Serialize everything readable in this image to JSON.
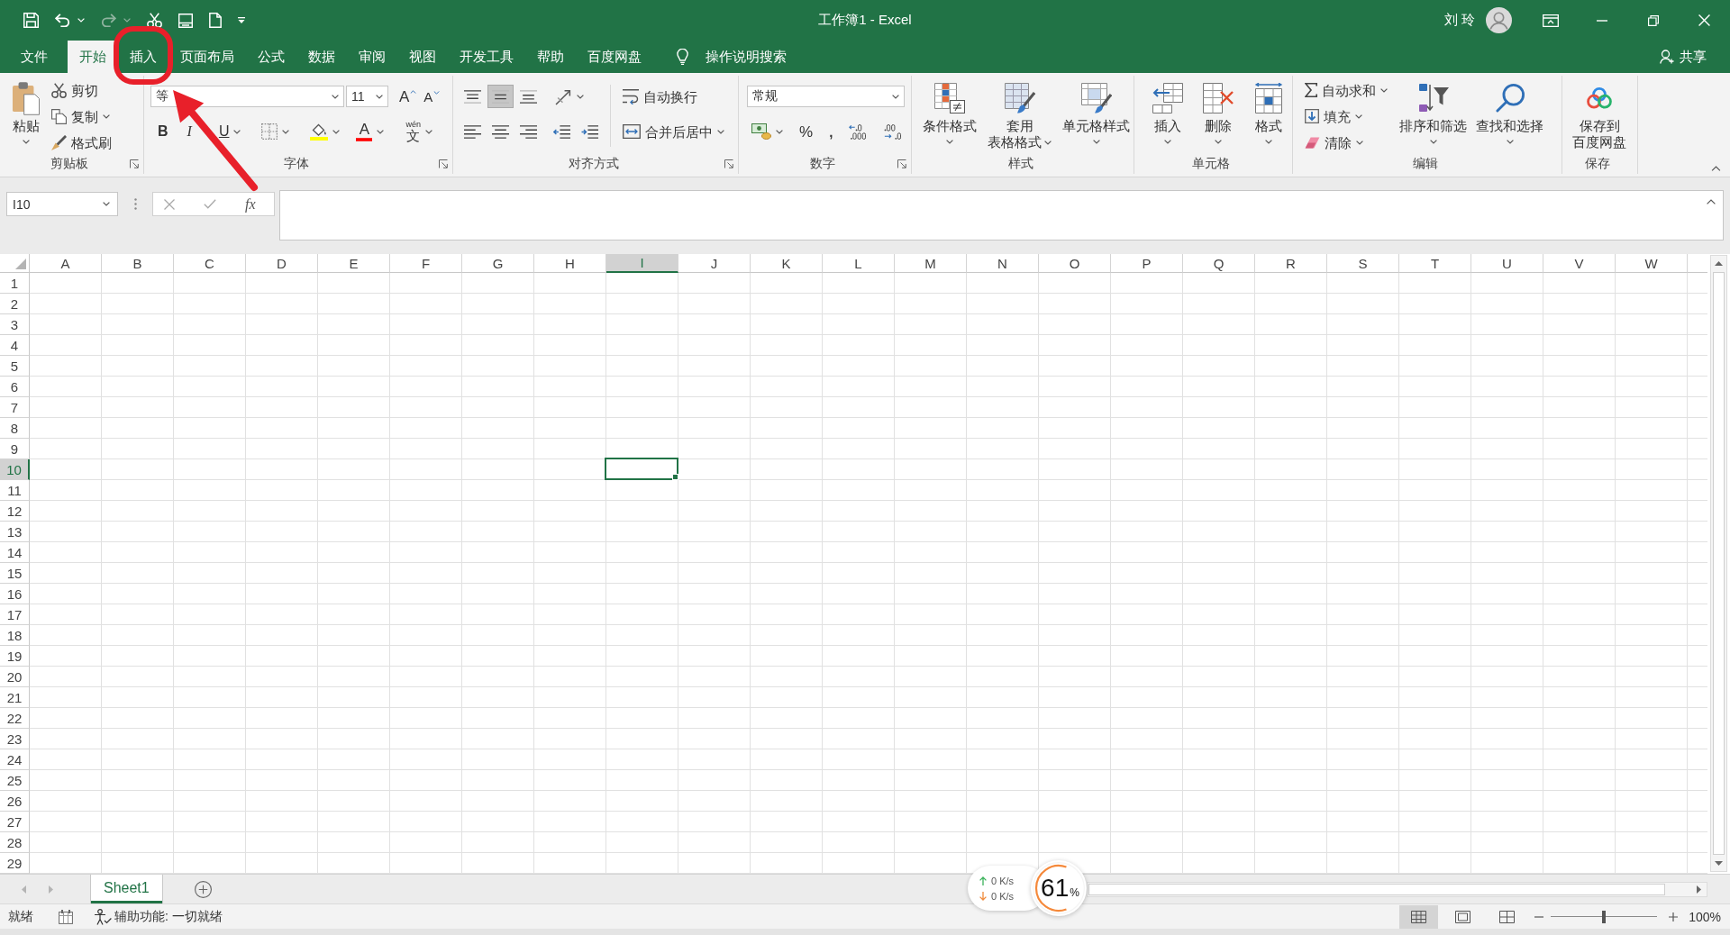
{
  "window": {
    "title": "工作簿1 - Excel",
    "user": "刘 玲"
  },
  "quick_access": [
    {
      "kind": "save",
      "disabled": false
    },
    {
      "kind": "undo",
      "disabled": false
    },
    {
      "kind": "redo",
      "disabled": true
    },
    {
      "kind": "cut",
      "disabled": false
    },
    {
      "kind": "form",
      "disabled": false
    },
    {
      "kind": "new",
      "disabled": false
    },
    {
      "kind": "customize",
      "disabled": false
    }
  ],
  "tabs": [
    {
      "label": "文件",
      "selected": false,
      "annotated": false
    },
    {
      "label": "开始",
      "selected": true,
      "annotated": false
    },
    {
      "label": "插入",
      "selected": false,
      "annotated": true
    },
    {
      "label": "页面布局",
      "selected": false,
      "annotated": false
    },
    {
      "label": "公式",
      "selected": false,
      "annotated": false
    },
    {
      "label": "数据",
      "selected": false,
      "annotated": false
    },
    {
      "label": "审阅",
      "selected": false,
      "annotated": false
    },
    {
      "label": "视图",
      "selected": false,
      "annotated": false
    },
    {
      "label": "开发工具",
      "selected": false,
      "annotated": false
    },
    {
      "label": "帮助",
      "selected": false,
      "annotated": false
    },
    {
      "label": "百度网盘",
      "selected": false,
      "annotated": false
    }
  ],
  "tell_me": {
    "label": "操作说明搜索"
  },
  "share": {
    "label": "共享"
  },
  "ribbon": {
    "groups": [
      {
        "title": "剪贴板",
        "launcher": true,
        "blocks": [
          {
            "kind": "large",
            "items": [
              {
                "kind": "paste",
                "lines": [
                  "粘贴"
                ],
                "menu": true
              }
            ]
          },
          {
            "kind": "stack",
            "items": [
              {
                "kind": "cut",
                "label": "剪切",
                "menu": false
              },
              {
                "kind": "copy",
                "label": "复制",
                "menu": true
              },
              {
                "kind": "painter",
                "label": "格式刷",
                "menu": false
              }
            ]
          }
        ]
      },
      {
        "title": "字体",
        "launcher": true,
        "blocks": [
          {
            "kind": "rows",
            "rows": [
              [
                {
                  "kind": "font-name",
                  "value": "等"
                },
                {
                  "kind": "font-size",
                  "value": "11"
                },
                {
                  "kind": "grow",
                  "label": "A",
                  "menu": false
                },
                {
                  "kind": "shrink",
                  "label": "A",
                  "menu": false
                }
              ],
              [
                {
                  "kind": "bold",
                  "label": "B",
                  "menu": false
                },
                {
                  "kind": "italic",
                  "label": "I",
                  "menu": false
                },
                {
                  "kind": "underline",
                  "label": "U",
                  "menu": true
                },
                {
                  "kind": "borders",
                  "menu": true
                },
                {
                  "kind": "fill",
                  "menu": true
                },
                {
                  "kind": "font-color",
                  "label": "A",
                  "menu": true
                },
                {
                  "kind": "phonetic",
                  "ruby": "wén",
                  "label": "文",
                  "menu": true
                }
              ]
            ]
          }
        ]
      },
      {
        "title": "对齐方式",
        "launcher": true,
        "blocks": [
          {
            "kind": "rows",
            "rows": [
              [
                {
                  "kind": "align-top",
                  "selected": false,
                  "menu": false
                },
                {
                  "kind": "align-middle",
                  "selected": true,
                  "menu": false
                },
                {
                  "kind": "align-bottom",
                  "selected": false,
                  "menu": false
                },
                {
                  "kind": "orientation",
                  "selected": false,
                  "menu": true
                }
              ],
              [
                {
                  "kind": "align-left",
                  "selected": false,
                  "menu": false
                },
                {
                  "kind": "align-center",
                  "selected": false,
                  "menu": false
                },
                {
                  "kind": "align-right",
                  "selected": false,
                  "menu": false
                },
                {
                  "kind": "indent-less",
                  "selected": false,
                  "menu": false
                },
                {
                  "kind": "indent-more",
                  "selected": false,
                  "menu": false
                }
              ]
            ]
          },
          {
            "kind": "rows",
            "rows": [
              [
                {
                  "kind": "wrap",
                  "label": "自动换行",
                  "selected": false,
                  "menu": false
                }
              ],
              [
                {
                  "kind": "merge",
                  "label": "合并后居中",
                  "selected": false,
                  "menu": true
                }
              ]
            ]
          }
        ]
      },
      {
        "title": "数字",
        "launcher": true,
        "blocks": [
          {
            "kind": "rows",
            "rows": [
              [
                {
                  "kind": "number-format",
                  "value": "常规"
                }
              ],
              [
                {
                  "kind": "accounting",
                  "menu": true
                },
                {
                  "kind": "percent",
                  "label": "%",
                  "menu": false
                },
                {
                  "kind": "comma",
                  "label": ",",
                  "menu": false
                },
                {
                  "kind": "decimal-more",
                  "menu": false
                },
                {
                  "kind": "decimal-less",
                  "menu": false
                }
              ]
            ]
          }
        ]
      },
      {
        "title": "样式",
        "launcher": false,
        "blocks": [
          {
            "kind": "large",
            "items": [
              {
                "kind": "conditional",
                "lines": [
                  "条件格式"
                ],
                "menu": true
              },
              {
                "kind": "table-format",
                "lines": [
                  "套用",
                  "表格格式"
                ],
                "menu": true
              },
              {
                "kind": "cell-styles",
                "lines": [
                  "单元格样式"
                ],
                "menu": true
              }
            ]
          }
        ]
      },
      {
        "title": "单元格",
        "launcher": false,
        "blocks": [
          {
            "kind": "large",
            "items": [
              {
                "kind": "insert-cells",
                "lines": [
                  "插入"
                ],
                "menu": true
              },
              {
                "kind": "delete-cells",
                "lines": [
                  "删除"
                ],
                "menu": true
              },
              {
                "kind": "format-cells",
                "lines": [
                  "格式"
                ],
                "menu": true
              }
            ]
          }
        ]
      },
      {
        "title": "编辑",
        "launcher": false,
        "blocks": [
          {
            "kind": "stack",
            "items": [
              {
                "kind": "autosum",
                "label": "自动求和",
                "menu": true
              },
              {
                "kind": "fill-down",
                "label": "填充",
                "menu": true
              },
              {
                "kind": "clear",
                "label": "清除",
                "menu": true
              }
            ]
          },
          {
            "kind": "large",
            "items": [
              {
                "kind": "sort",
                "lines": [
                  "排序和筛选"
                ],
                "menu": true
              },
              {
                "kind": "find",
                "lines": [
                  "查找和选择"
                ],
                "menu": true
              }
            ]
          }
        ]
      },
      {
        "title": "保存",
        "launcher": false,
        "blocks": [
          {
            "kind": "large",
            "items": [
              {
                "kind": "cloud-save",
                "lines": [
                  "保存到",
                  "百度网盘"
                ],
                "menu": false
              }
            ]
          }
        ]
      }
    ]
  },
  "formula_bar": {
    "name_box": "I10",
    "buttons": [
      {
        "kind": "cancel",
        "disabled": true
      },
      {
        "kind": "enter",
        "disabled": true
      },
      {
        "kind": "function",
        "label": "fx",
        "disabled": false
      }
    ]
  },
  "sheet": {
    "columns": [
      {
        "label": "A",
        "selected": false
      },
      {
        "label": "B",
        "selected": false
      },
      {
        "label": "C",
        "selected": false
      },
      {
        "label": "D",
        "selected": false
      },
      {
        "label": "E",
        "selected": false
      },
      {
        "label": "F",
        "selected": false
      },
      {
        "label": "G",
        "selected": false
      },
      {
        "label": "H",
        "selected": false
      },
      {
        "label": "I",
        "selected": true
      },
      {
        "label": "J",
        "selected": false
      },
      {
        "label": "K",
        "selected": false
      },
      {
        "label": "L",
        "selected": false
      },
      {
        "label": "M",
        "selected": false
      },
      {
        "label": "N",
        "selected": false
      },
      {
        "label": "O",
        "selected": false
      },
      {
        "label": "P",
        "selected": false
      },
      {
        "label": "Q",
        "selected": false
      },
      {
        "label": "R",
        "selected": false
      },
      {
        "label": "S",
        "selected": false
      },
      {
        "label": "T",
        "selected": false
      },
      {
        "label": "U",
        "selected": false
      },
      {
        "label": "V",
        "selected": false
      },
      {
        "label": "W",
        "selected": false
      }
    ],
    "rows": [
      {
        "label": "1",
        "selected": false
      },
      {
        "label": "2",
        "selected": false
      },
      {
        "label": "3",
        "selected": false
      },
      {
        "label": "4",
        "selected": false
      },
      {
        "label": "5",
        "selected": false
      },
      {
        "label": "6",
        "selected": false
      },
      {
        "label": "7",
        "selected": false
      },
      {
        "label": "8",
        "selected": false
      },
      {
        "label": "9",
        "selected": false
      },
      {
        "label": "10",
        "selected": true
      },
      {
        "label": "11",
        "selected": false
      },
      {
        "label": "12",
        "selected": false
      },
      {
        "label": "13",
        "selected": false
      },
      {
        "label": "14",
        "selected": false
      },
      {
        "label": "15",
        "selected": false
      },
      {
        "label": "16",
        "selected": false
      },
      {
        "label": "17",
        "selected": false
      },
      {
        "label": "18",
        "selected": false
      },
      {
        "label": "19",
        "selected": false
      },
      {
        "label": "20",
        "selected": false
      },
      {
        "label": "21",
        "selected": false
      },
      {
        "label": "22",
        "selected": false
      },
      {
        "label": "23",
        "selected": false
      },
      {
        "label": "24",
        "selected": false
      },
      {
        "label": "25",
        "selected": false
      },
      {
        "label": "26",
        "selected": false
      },
      {
        "label": "27",
        "selected": false
      },
      {
        "label": "28",
        "selected": false
      },
      {
        "label": "29",
        "selected": false
      }
    ]
  },
  "sheet_nav": [
    {
      "kind": "previous",
      "disabled": true
    },
    {
      "kind": "next",
      "disabled": true
    }
  ],
  "sheet_tabs": [
    {
      "label": "Sheet1",
      "selected": true
    }
  ],
  "status_bar": {
    "mode": "就绪",
    "accessibility": "辅助功能: 一切就绪",
    "views": [
      {
        "kind": "normal",
        "selected": true
      },
      {
        "kind": "page-layout",
        "selected": false
      },
      {
        "kind": "page-break",
        "selected": false
      }
    ],
    "zoom": {
      "level": 0.5,
      "reading": "100%"
    }
  },
  "net_widget": {
    "upload": "0 K/s",
    "download": "0 K/s",
    "reading": "61",
    "unit": "%",
    "level": 0.61
  }
}
